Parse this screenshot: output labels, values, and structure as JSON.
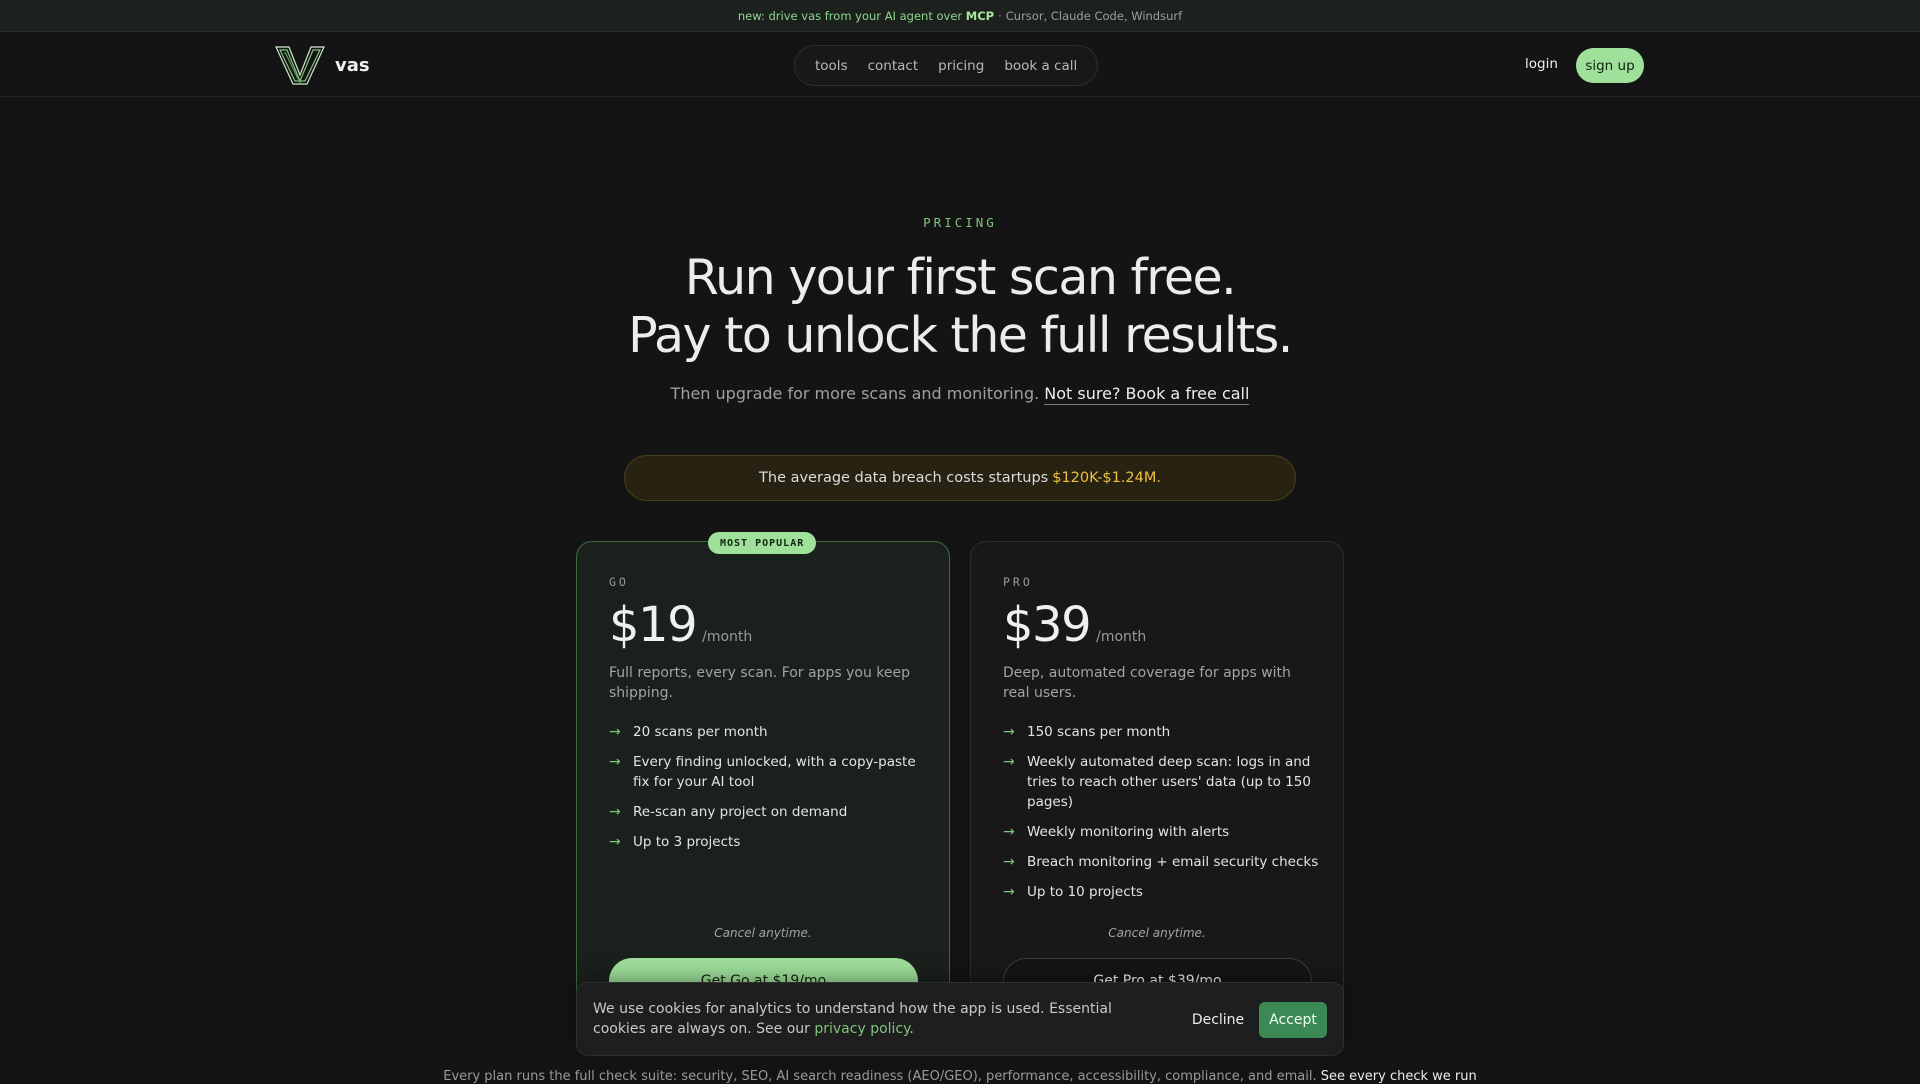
{
  "announcement": {
    "prefix": "new: drive vas from your AI agent over",
    "highlight": "MCP",
    "separator": "·",
    "suffix": "Cursor, Claude Code, Windsurf"
  },
  "nav": {
    "brand": "vas",
    "links": [
      "tools",
      "contact",
      "pricing",
      "book a call"
    ],
    "login": "login",
    "signup": "sign up"
  },
  "hero": {
    "eyebrow": "PRICING",
    "headline_line1": "Run your first scan free.",
    "headline_line2": "Pay to unlock the full results.",
    "subline": "Then upgrade for more scans and monitoring.",
    "subline_link": "Not sure? Book a free call"
  },
  "breach_banner": {
    "text": "The average data breach costs startups",
    "amount": "$120K-$1.24M."
  },
  "plans": [
    {
      "badge": "MOST POPULAR",
      "name": "GO",
      "price": "$19",
      "period": "/month",
      "description": "Full reports, every scan. For apps you keep shipping.",
      "features": [
        "20 scans per month",
        "Every finding unlocked, with a copy-paste fix for your AI tool",
        "Re-scan any project on demand",
        "Up to 3 projects"
      ],
      "cancel_note": "Cancel anytime.",
      "cta": "Get Go at $19/mo"
    },
    {
      "name": "PRO",
      "price": "$39",
      "period": "/month",
      "description": "Deep, automated coverage for apps with real users.",
      "features": [
        "150 scans per month",
        "Weekly automated deep scan: logs in and tries to reach other users' data (up to 150 pages)",
        "Weekly monitoring with alerts",
        "Breach monitoring + email security checks",
        "Up to 10 projects"
      ],
      "cancel_note": "Cancel anytime.",
      "cta": "Get Pro at $39/mo"
    }
  ],
  "footer_note": {
    "text": "Every plan runs the full check suite: security, SEO, AI search readiness (AEO/GEO), performance, accessibility, compliance, and email.",
    "link": "See every check we run"
  },
  "cookie_banner": {
    "text": "We use cookies for analytics to understand how the app is used. Essential cookies are always on. See our",
    "link": "privacy policy",
    "link_suffix": ".",
    "decline": "Decline",
    "accept": "Accept"
  },
  "icons": {
    "feature_bullet": "arrow-right-icon",
    "logo": "v-logo-icon"
  },
  "colors": {
    "background": "#141414",
    "accent_green": "#9fe09a",
    "accept_green": "#3b8a55",
    "breach_gold": "#f0c040"
  }
}
